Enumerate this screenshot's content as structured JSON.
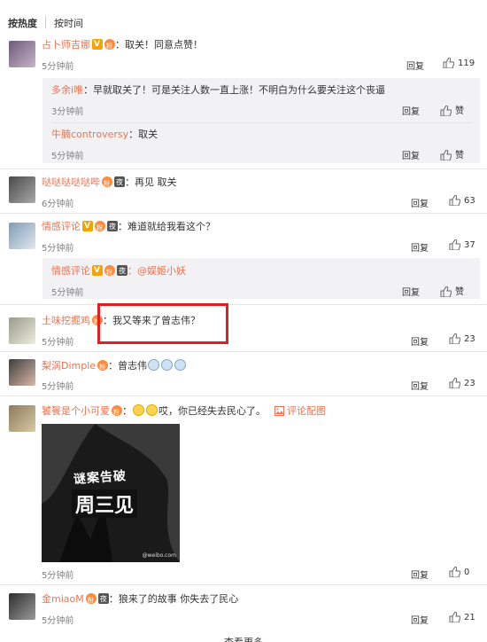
{
  "tabs": {
    "hot": "按热度",
    "time": "按时间"
  },
  "comments": [
    {
      "user": "占卜师吉娜",
      "text": "：取关！同意点赞！",
      "time": "5分钟前",
      "reply": "回复",
      "likes": "119",
      "subs": [
        {
          "user": "多余i唯",
          "text": "：早就取关了！可是关注人数一直上涨！不明白为什么要关注这个丧逼",
          "time": "3分钟前",
          "reply": "回复",
          "likes": "赞"
        },
        {
          "user": "牛腩controversy",
          "text": "：取关",
          "time": "5分钟前",
          "reply": "回复",
          "likes": "赞"
        }
      ]
    },
    {
      "user": "哒哒哒哒哒哔",
      "text": "：再见 取关",
      "time": "6分钟前",
      "reply": "回复",
      "likes": "63"
    },
    {
      "user": "情感评论",
      "text": "：难道就给我看这个？",
      "time": "5分钟前",
      "reply": "回复",
      "likes": "37",
      "subs": [
        {
          "user": "情感评论",
          "text": "：@娱姬小妖",
          "time": "5分钟前",
          "reply": "回复",
          "likes": "赞"
        }
      ]
    },
    {
      "user": "土味挖掘鸡",
      "text": "：我又等来了曾志伟？",
      "time": "5分钟前",
      "reply": "回复",
      "likes": "23"
    },
    {
      "user": "梨涡Dimple",
      "text": "：曾志伟",
      "time": "5分钟前",
      "reply": "回复",
      "likes": "23"
    },
    {
      "user": "饕餮是个小可爱",
      "text": "哎，你已经失去民心了。",
      "link": "评论配图",
      "time": "5分钟前",
      "reply": "回复",
      "likes": "0",
      "image": {
        "title": "谜案告破",
        "main": "周三见",
        "watermark": "@weibo.com"
      }
    },
    {
      "user": "金miaoM",
      "text": "：狼来了的故事 你失去了民心",
      "time": "5分钟前",
      "reply": "回复",
      "likes": "21"
    }
  ],
  "more": "查看更多",
  "colors": {
    "username": "#eb7350",
    "highlight": "#e02020",
    "subbox": "#f2f2f5"
  }
}
